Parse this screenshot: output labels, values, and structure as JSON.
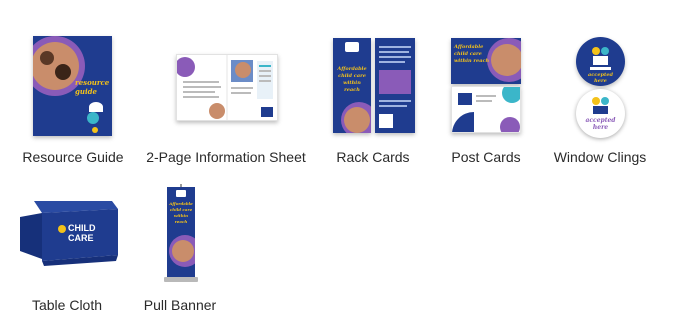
{
  "products": [
    {
      "id": "resource-guide",
      "label": "Resource Guide",
      "script_text": "resource guide"
    },
    {
      "id": "information-sheet",
      "label": "2-Page Information Sheet"
    },
    {
      "id": "rack-cards",
      "label": "Rack Cards",
      "script_text": "Affordable child care within reach"
    },
    {
      "id": "post-cards",
      "label": "Post Cards",
      "script_text": "Affordable child care within reach"
    },
    {
      "id": "window-clings",
      "label": "Window Clings",
      "script_text": "accepted here"
    },
    {
      "id": "table-cloth",
      "label": "Table Cloth",
      "brand_text": "CHILD CARE"
    },
    {
      "id": "pull-banner",
      "label": "Pull Banner",
      "script_text": "Affordable child care within reach"
    }
  ],
  "colors": {
    "navy": "#1f3c8f",
    "purple": "#8a5bb8",
    "gold": "#f4c21a",
    "teal": "#3bb6c9"
  }
}
